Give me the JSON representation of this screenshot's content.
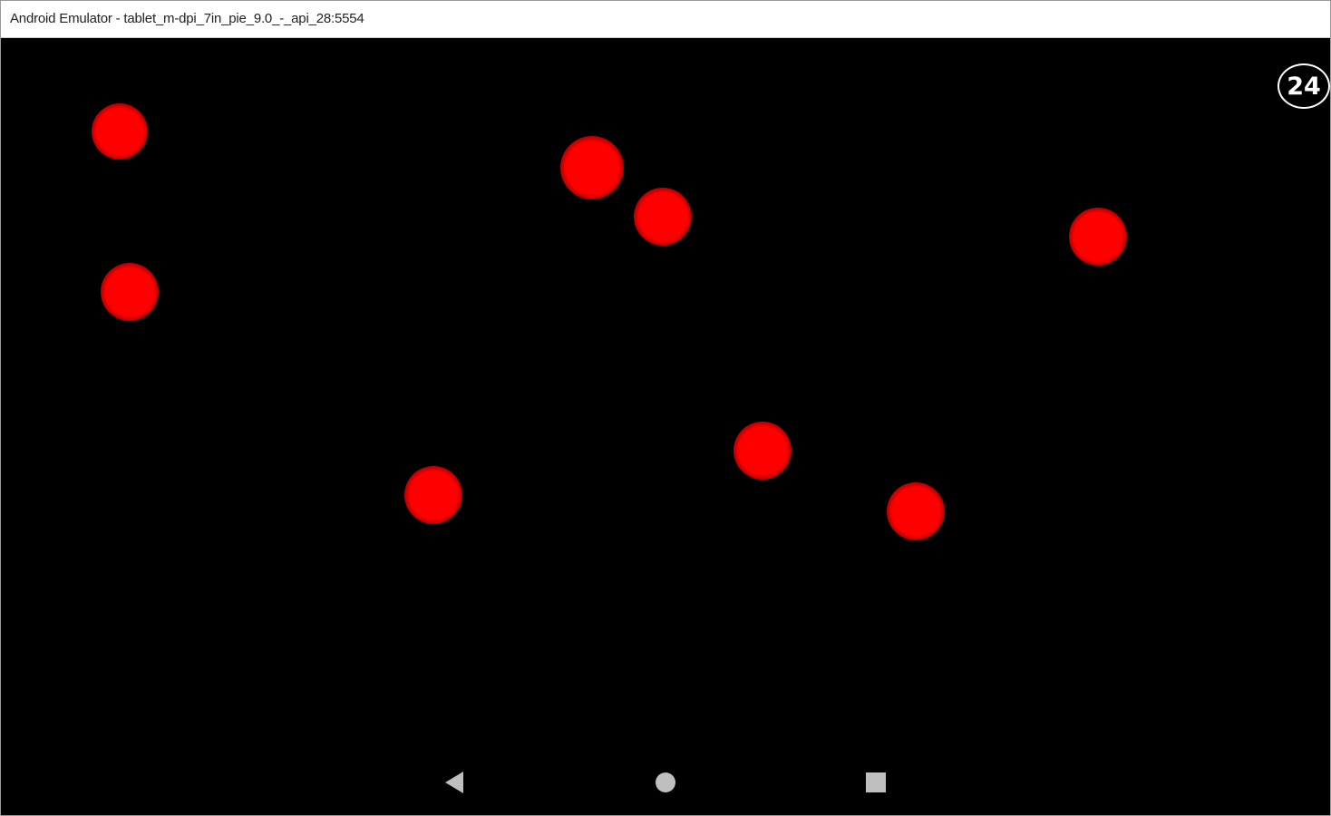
{
  "window": {
    "title": "Android Emulator - tablet_m-dpi_7in_pie_9.0_-_api_28:5554"
  },
  "game": {
    "score": "24",
    "ball_color": "#ff0000",
    "background_color": "#000000"
  },
  "navbar": {
    "back_icon": "back-triangle-icon",
    "home_icon": "home-circle-icon",
    "recents_icon": "recents-square-icon",
    "icon_color": "#bfbfbf"
  }
}
